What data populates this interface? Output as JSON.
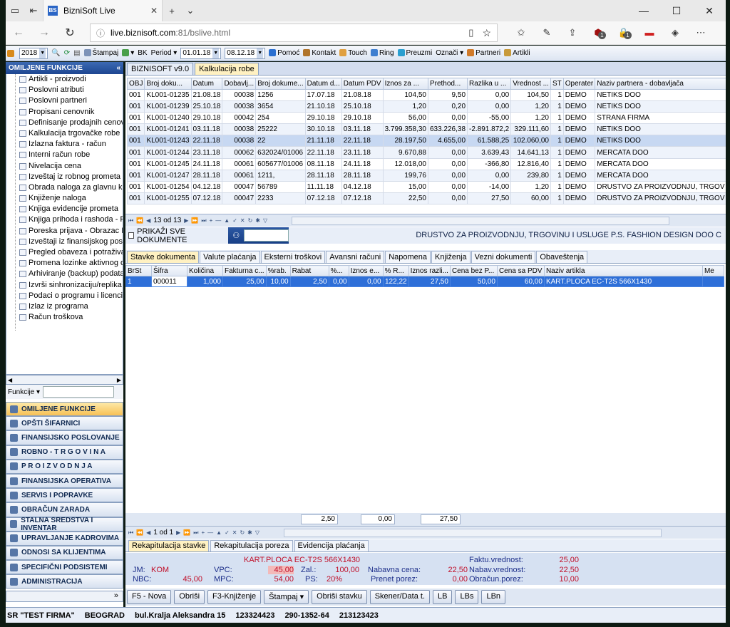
{
  "browser": {
    "tab_title": "BizniSoft Live",
    "url_host": "live.biznisoft.com",
    "url_rest": ":81/bslive.html",
    "badge1": "1",
    "badge2": "1"
  },
  "toolbar": {
    "year": "2018",
    "stampaj": "Štampaj",
    "bk": "BK",
    "period": "Period",
    "date_from": "01.01.18",
    "date_to": "08.12.18",
    "pomoc": "Pomoć",
    "kontakt": "Kontakt",
    "touch": "Touch",
    "ring": "Ring",
    "preuzmi": "Preuzmi",
    "oznaci": "Označi",
    "partneri": "Partneri",
    "artikli": "Artikli"
  },
  "left": {
    "header": "OMILJENE FUNKCIJE",
    "collapse": "«",
    "funkcije": "Funkcije",
    "chevron": "»",
    "tree": [
      "Artikli - proizvodi",
      "Poslovni atributi",
      "Poslovni partneri",
      "Propisani cenovnik",
      "Definisanje prodajnih cenov",
      "Kalkulacija trgovačke robe",
      "Izlazna faktura - račun",
      "Interni račun robe",
      "Nivelacija cena",
      "Izveštaj iz robnog prometa",
      "Obrada naloga za glavnu kn",
      "Knjiženje naloga",
      "Knjiga evidencije prometa",
      "Knjiga prihoda i rashoda - P",
      "Poreska prijava - Obrazac P",
      "Izveštaji iz finansijskog pos",
      "Pregled obaveza i potraživa",
      "Promena lozinke aktivnog o",
      "Arhiviranje (backup) podata",
      "Izvrši sinhronizaciju/replika",
      "Podaci o programu i licenci",
      "Izlaz iz programa",
      "Račun troškova"
    ],
    "accordion": [
      "OMILJENE FUNKCIJE",
      "OPŠTI ŠIFARNICI",
      "FINANSIJSKO POSLOVANJE",
      "ROBNO - T R G O V I N A",
      "P R O I Z V O D N J A",
      "FINANSIJSKA OPERATIVA",
      "SERVIS I POPRAVKE",
      "OBRAČUN ZARADA",
      "STALNA SREDSTVA I INVENTAR",
      "UPRAVLJANJE KADROVIMA",
      "ODNOSI SA KLIJENTIMA",
      "SPECIFIČNI PODSISTEMI",
      "ADMINISTRACIJA"
    ]
  },
  "main": {
    "tabs": [
      "BIZNISOFT v9.0",
      "Kalkulacija robe"
    ],
    "grid_cols": [
      "OBJ",
      "Broj doku...",
      "Datum",
      "Dobavlj...",
      "Broj dokume...",
      "Datum d...",
      "Datum PDV",
      "Iznos za ...",
      "Prethod...",
      "Razlika u ...",
      "Vrednost ...",
      "ST",
      "Operater",
      "Naziv partnera - dobavljača"
    ],
    "rows": [
      [
        "001",
        "KL001-01235",
        "21.08.18",
        "00038",
        "1256",
        "17.07.18",
        "21.08.18",
        "104,50",
        "9,50",
        "0,00",
        "104,50",
        "1",
        "DEMO",
        "NETIKS DOO"
      ],
      [
        "001",
        "KL001-01239",
        "25.10.18",
        "00038",
        "3654",
        "21.10.18",
        "25.10.18",
        "1,20",
        "0,20",
        "0,00",
        "1,20",
        "1",
        "DEMO",
        "NETIKS DOO"
      ],
      [
        "001",
        "KL001-01240",
        "29.10.18",
        "00042",
        "254",
        "29.10.18",
        "29.10.18",
        "56,00",
        "0,00",
        "-55,00",
        "1,20",
        "1",
        "DEMO",
        "STRANA FIRMA"
      ],
      [
        "001",
        "KL001-01241",
        "03.11.18",
        "00038",
        "25222",
        "30.10.18",
        "03.11.18",
        "3.799.358,30",
        "633.226,38",
        "-2.891.872,2",
        "329.111,60",
        "1",
        "DEMO",
        "NETIKS DOO"
      ],
      [
        "001",
        "KL001-01243",
        "22.11.18",
        "00038",
        "22",
        "21.11.18",
        "22.11.18",
        "28.197,50",
        "4.655,00",
        "61.588,25",
        "102.060,00",
        "1",
        "DEMO",
        "NETIKS DOO"
      ],
      [
        "001",
        "KL001-01244",
        "23.11.18",
        "00062",
        "632024/01006",
        "22.11.18",
        "23.11.18",
        "9.670,88",
        "0,00",
        "3.639,43",
        "14.641,13",
        "1",
        "DEMO",
        "MERCATA DOO"
      ],
      [
        "001",
        "KL001-01245",
        "24.11.18",
        "00061",
        "605677/01006",
        "08.11.18",
        "24.11.18",
        "12.018,00",
        "0,00",
        "-366,80",
        "12.816,40",
        "1",
        "DEMO",
        "MERCATA DOO"
      ],
      [
        "001",
        "KL001-01247",
        "28.11.18",
        "00061",
        "1211,",
        "28.11.18",
        "28.11.18",
        "199,76",
        "0,00",
        "0,00",
        "239,80",
        "1",
        "DEMO",
        "MERCATA DOO"
      ],
      [
        "001",
        "KL001-01254",
        "04.12.18",
        "00047",
        "56789",
        "11.11.18",
        "04.12.18",
        "15,00",
        "0,00",
        "-14,00",
        "1,20",
        "1",
        "DEMO",
        "DRUSTVO ZA PROIZVODNJU, TRGOV"
      ],
      [
        "001",
        "KL001-01255",
        "07.12.18",
        "00047",
        "2233",
        "07.12.18",
        "07.12.18",
        "22,50",
        "0,00",
        "27,50",
        "60,00",
        "1",
        "DEMO",
        "DRUSTVO ZA PROIZVODNJU, TRGOV"
      ]
    ],
    "nav1_pos": "13 od 13",
    "prikazi": "PRIKAŽI SVE DOKUMENTE",
    "partner_full": "DRUSTVO ZA PROIZVODNJU, TRGOVINU I USLUGE P.S. FASHION DESIGN DOO C",
    "subtabs": [
      "Stavke dokumenta",
      "Valute plaćanja",
      "Eksterni troškovi",
      "Avansni računi",
      "Napomena",
      "Knjiženja",
      "Vezni dokumenti",
      "Obaveštenja"
    ],
    "grid2_cols": [
      "BrSt",
      "Šifra",
      "Količina",
      "Fakturna c...",
      "%rab.",
      "Rabat",
      "%...",
      "Iznos e...",
      "% R...",
      "Iznos razli...",
      "Cena bez P...",
      "Cena sa PDV",
      "Naziv artikla",
      "Me"
    ],
    "grid2_row": [
      "1",
      "000011",
      "1,000",
      "25,00",
      "10,00",
      "2,50",
      "0,00",
      "0,00",
      "122,22",
      "27,50",
      "50,00",
      "60,00",
      "KART.PLOCA   EC-T2S   566X1430",
      ""
    ],
    "sums": [
      "2,50",
      "0,00",
      "27,50"
    ],
    "nav2_pos": "1 od 1",
    "rektabs": [
      "Rekapitulacija stavke",
      "Rekapitulacija poreza",
      "Evidencija plaćanja"
    ],
    "rekap": {
      "article": "KART.PLOCA   EC-T2S   566X1430",
      "jm_l": "JM:",
      "jm_v": "KOM",
      "vpc_l": "VPC:",
      "vpc_v": "45,00",
      "zal_l": "Zal.:",
      "zal_v": "100,00",
      "nbc_l": "NBC:",
      "nbc_v": "45,00",
      "mpc_l": "MPC:",
      "mpc_v": "54,00",
      "ps_l": "PS:",
      "ps_v": "20%",
      "nab_l": "Nabavna cena:",
      "nab_v": "22,50",
      "prenet_l": "Prenet porez:",
      "prenet_v": "0,00",
      "fv_l": "Faktu.vrednost:",
      "fv_v": "25,00",
      "nv_l": "Nabav.vrednost:",
      "nv_v": "22,50",
      "op_l": "Obračun.porez:",
      "op_v": "10,00"
    },
    "buttons": [
      "F5 - Nova",
      "Obriši",
      "F3-Knjiženje",
      "Štampaj",
      "Obriši stavku",
      "Skener/Data t.",
      "LB",
      "LBs",
      "LBn"
    ]
  },
  "status": {
    "firm": "SR \"TEST FIRMA\"",
    "city": "BEOGRAD",
    "address": "bul.Kralja Aleksandra 15",
    "pib": "123324423",
    "acct": "290-1352-64",
    "mb": "213123423"
  }
}
